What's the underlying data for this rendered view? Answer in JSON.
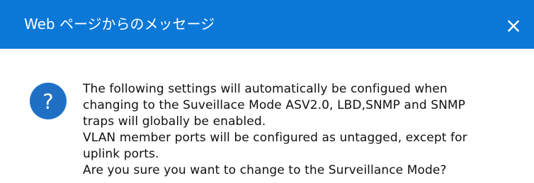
{
  "window": {
    "title": "Web ページからのメッセージ",
    "close_symbol": "×"
  },
  "dialog": {
    "icon": "question-icon",
    "icon_symbol": "?",
    "lines": [
      "The following settings will automatically be configued when",
      "changing to the Suveillace Mode ASV2.0, LBD,SNMP and SNMP",
      "traps will globally be enabled.",
      "VLAN member ports will be configured as untagged, except for",
      "uplink ports.",
      " Are you sure you want to change to the Surveillance Mode?"
    ]
  },
  "colors": {
    "titlebar": "#0b78d7",
    "icon": "#1f6fc5"
  }
}
